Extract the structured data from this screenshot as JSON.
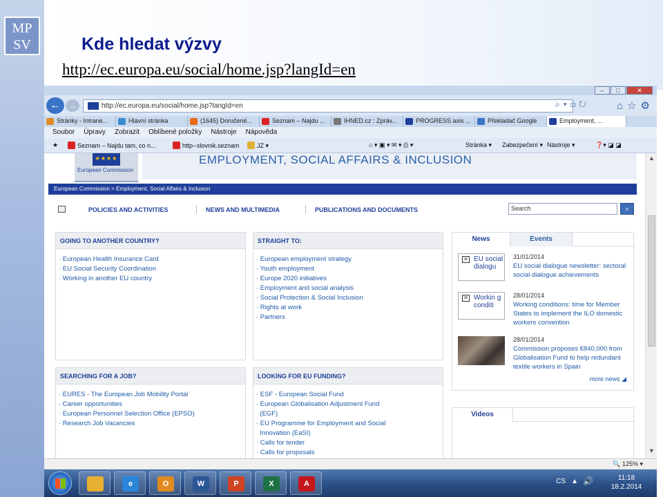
{
  "slide": {
    "logo_line1": "MP",
    "logo_line2": "SV",
    "title": "Kde hledat výzvy",
    "url": "http://ec.europa.eu/social/home.jsp?langId=en"
  },
  "browser": {
    "address": "http://ec.europa.eu/social/home.jsp?langId=en",
    "tabs": [
      {
        "label": "Stránky - Intrane...",
        "color": "#e08a2a"
      },
      {
        "label": "Hlavní stránka",
        "color": "#3a8ad0"
      },
      {
        "label": "(1645) Doručené...",
        "color": "#e86a1a"
      },
      {
        "label": "Seznam – Najdu ...",
        "color": "#d22"
      },
      {
        "label": "IHNED.cz : Zpráv...",
        "color": "#777"
      },
      {
        "label": "PROGRESS axis ...",
        "color": "#1f3f9a"
      },
      {
        "label": "Překladač Google",
        "color": "#3a73c6"
      },
      {
        "label": "Employment, ...",
        "color": "#1f3f9a"
      }
    ],
    "menu": [
      "Soubor",
      "Úpravy",
      "Zobrazit",
      "Oblíbené položky",
      "Nástroje",
      "Nápověda"
    ],
    "favorites": [
      {
        "label": "Seznam – Najdu tam, co n...",
        "color": "#d22"
      },
      {
        "label": "http--slovnik.seznam",
        "color": "#d22"
      },
      {
        "label": "JZ ▾",
        "color": "#e0b030"
      }
    ],
    "commands": [
      "Stránka ▾",
      "Zabezpečení ▾",
      "Nástroje ▾"
    ],
    "zoom": "125%"
  },
  "page": {
    "logo_text": "European Commission",
    "header_title": "EMPLOYMENT, SOCIAL AFFAIRS & INCLUSION",
    "breadcrumb": "European Commission > Employment, Social Affairs & Inclusion",
    "nav": [
      "POLICIES AND ACTIVITIES",
      "NEWS AND MULTIMEDIA",
      "PUBLICATIONS AND DOCUMENTS"
    ],
    "search_placeholder": "Search",
    "boxes": {
      "going": {
        "title": "GOING TO ANOTHER COUNTRY?",
        "links": [
          "· European Health Insurance Card",
          "· EU Social Security Coordination",
          "· Working in another EU country"
        ]
      },
      "straight": {
        "title": "STRAIGHT TO:",
        "links": [
          "· European employment strategy",
          "· Youth employment",
          "· Europe 2020 initiatives",
          "· Employment and social analysis",
          "· Social Protection & Social Inclusion",
          "· Rights at work",
          "· Partners"
        ]
      },
      "job": {
        "title": "SEARCHING FOR A JOB?",
        "links": [
          "· EURES - The European Job Mobility Portal",
          "· Career opportunities",
          "· European Personnel Selection Office (EPSO)",
          "· Research Job Vacancies"
        ]
      },
      "funding": {
        "title": "LOOKING FOR EU FUNDING?",
        "links": [
          "· ESF - European Social Fund",
          "· European Globalisation Adjustment Fund",
          "  (EGF)",
          "· EU Programme for Employment and Social",
          "  Innovation (EaSI)",
          "· Calls for tender",
          "· Calls for proposals"
        ]
      }
    },
    "news": {
      "tab_news": "News",
      "tab_events": "Events",
      "items": [
        {
          "thumb": "EU social dialogu",
          "date": "31/01/2014",
          "text": "EU social dialogue newsletter: sectoral social dialogue achievements"
        },
        {
          "thumb": "Workin g conditi",
          "date": "28/01/2014",
          "text": "Working conditions: time for Member States to implement the ILO domestic workers convention"
        },
        {
          "thumb": "",
          "date": "28/01/2014",
          "text": "Commission proposes €840,000 from Globalisation Fund to help redundant textile workers in Spain"
        }
      ],
      "more": "more news ◢"
    },
    "videos_tab": "Videos"
  },
  "taskbar": {
    "apps": [
      {
        "name": "explorer",
        "color": "#e8b030",
        "glyph": ""
      },
      {
        "name": "ie",
        "color": "#2a86d8",
        "glyph": "e"
      },
      {
        "name": "outlook",
        "color": "#e08a20",
        "glyph": "O"
      },
      {
        "name": "word",
        "color": "#2b5797",
        "glyph": "W"
      },
      {
        "name": "powerpoint",
        "color": "#d04525",
        "glyph": "P"
      },
      {
        "name": "excel",
        "color": "#1e7145",
        "glyph": "X"
      },
      {
        "name": "acrobat",
        "color": "#c4161c",
        "glyph": "A"
      }
    ],
    "lang": "CS",
    "time": "11:18",
    "date": "18.2.2014"
  }
}
